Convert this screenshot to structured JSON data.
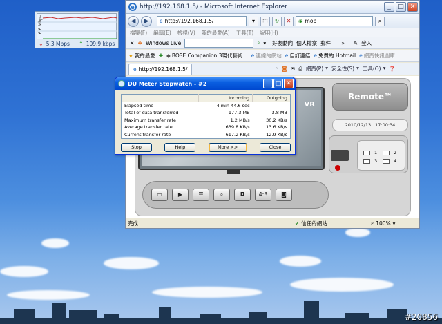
{
  "desktop": {
    "watermark": "#20856"
  },
  "du_meter": {
    "scale_label": "6.6 Mbps",
    "download_rate": "5.3 Mbps",
    "upload_rate": "109.9 kbps"
  },
  "browser": {
    "title": "http://192.168.1.5/ - Microsoft Internet Explorer",
    "address": "http://192.168.1.5/",
    "search_text": "mob",
    "menu": [
      "檔案(F)",
      "編輯(E)",
      "檢視(V)",
      "我的最愛(A)",
      "工具(T)",
      "說明(H)"
    ],
    "live_label": "Windows Live",
    "toolbar_links": [
      "好友動向",
      "個人檔案",
      "郵件"
    ],
    "signin": "登入",
    "fav_label": "我的最愛",
    "favorites": [
      "BOSE Companion 3現代藝術...",
      "連線的網站",
      "自訂連結",
      "免費的 Hotmail",
      "網頁快訊圖庫"
    ],
    "tab_label": "http://192.168.1.5/",
    "commands": [
      "網頁(P)",
      "安全性(S)",
      "工具(O)"
    ],
    "status_text": "完成",
    "zone_text": "信任的網站",
    "zoom": "100%"
  },
  "app": {
    "remote_label": "Remote™",
    "date": "2010/12/13",
    "time": "17:00:34",
    "overlay_text": "VR",
    "ratio_label": "4:3",
    "cams": [
      "1",
      "2",
      "3",
      "4"
    ]
  },
  "stopwatch": {
    "title": "DU Meter Stopwatch - #2",
    "col_incoming": "Incoming",
    "col_outgoing": "Outgoing",
    "rows": [
      {
        "label": "Elapsed time",
        "incoming": "4 min 44.6 sec",
        "outgoing": ""
      },
      {
        "label": "Total of data transferred",
        "incoming": "177.3 MB",
        "outgoing": "3.8 MB"
      },
      {
        "label": "Maximum transfer rate",
        "incoming": "1.2 MB/s",
        "outgoing": "30.2 KB/s"
      },
      {
        "label": "Average transfer rate",
        "incoming": "639.8 KB/s",
        "outgoing": "13.6 KB/s"
      },
      {
        "label": "Current transfer rate",
        "incoming": "617.2 KB/s",
        "outgoing": "12.9 KB/s"
      }
    ],
    "buttons": {
      "stop": "Stop",
      "help": "Help",
      "more": "More >>",
      "close": "Close"
    }
  }
}
